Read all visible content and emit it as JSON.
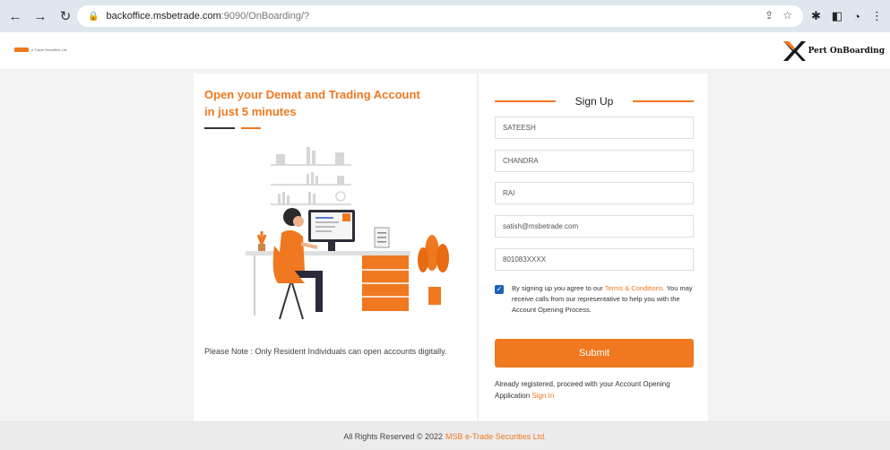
{
  "browser": {
    "url_host": "backoffice.msbetrade.com",
    "url_path": ":9090/OnBoarding/?"
  },
  "header": {
    "brand_text": "e-Trade Securities Ltd.",
    "partner_label": "Pert OnBoarding"
  },
  "left": {
    "headline_line1": "Open your Demat and Trading Account",
    "headline_line2": "in just 5 minutes",
    "note": "Please Note : Only Resident Individuals can open accounts digitally."
  },
  "signup": {
    "title": "Sign Up",
    "fields": [
      {
        "value": "SATEESH"
      },
      {
        "value": "CHANDRA"
      },
      {
        "value": "RAI"
      },
      {
        "value": "satish@msbetrade.com"
      },
      {
        "value": "801083XXXX"
      }
    ],
    "consent_prefix": "By signing up you agree to our ",
    "consent_link": "Terms & Conditions.",
    "consent_suffix": " You may receive calls from our representative to help you with the Account Opening Process.",
    "submit_label": "Submit",
    "already_text": "Already registered, proceed with your Account Opening Application ",
    "sign_in_label": "Sign In"
  },
  "footer": {
    "text": "All Rights Reserved © 2022",
    "company": "MSB e-Trade Securities Ltd."
  },
  "colors": {
    "accent": "#f07820",
    "checkbox": "#1f5fb8"
  }
}
